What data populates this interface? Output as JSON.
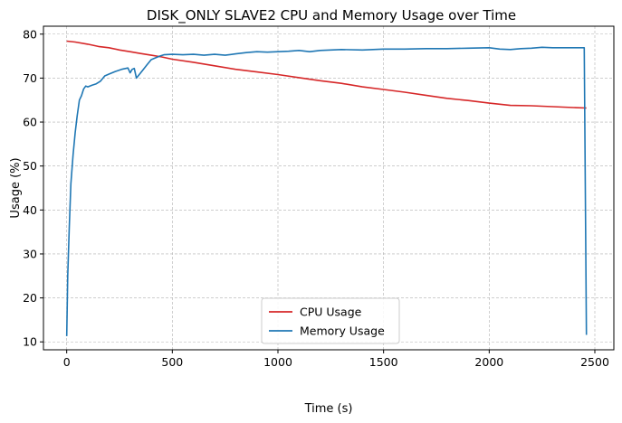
{
  "chart_data": {
    "type": "line",
    "title": "DISK_ONLY SLAVE2 CPU and Memory Usage over Time",
    "xlabel": "Time (s)",
    "ylabel": "Usage (%)",
    "xlim": [
      -110,
      2590
    ],
    "ylim": [
      8.2,
      81.8
    ],
    "xticks": [
      0,
      500,
      1000,
      1500,
      2000,
      2500
    ],
    "yticks": [
      10,
      20,
      30,
      40,
      50,
      60,
      70,
      80
    ],
    "grid": true,
    "legend": "lower-center",
    "series": [
      {
        "name": "CPU Usage",
        "color": "#d62728",
        "x": [
          0,
          40,
          100,
          150,
          200,
          250,
          300,
          350,
          400,
          450,
          500,
          600,
          700,
          800,
          900,
          1000,
          1100,
          1200,
          1300,
          1400,
          1500,
          1600,
          1700,
          1800,
          1900,
          2000,
          2100,
          2200,
          2300,
          2400,
          2460
        ],
        "y": [
          78.4,
          78.2,
          77.7,
          77.2,
          76.9,
          76.4,
          76.0,
          75.6,
          75.2,
          74.8,
          74.3,
          73.6,
          72.8,
          72.0,
          71.4,
          70.8,
          70.1,
          69.4,
          68.8,
          68.0,
          67.4,
          66.8,
          66.1,
          65.4,
          64.9,
          64.3,
          63.8,
          63.7,
          63.5,
          63.3,
          63.2
        ]
      },
      {
        "name": "Memory Usage",
        "color": "#1f77b4",
        "x": [
          0,
          5,
          12,
          20,
          30,
          40,
          50,
          60,
          70,
          80,
          90,
          100,
          120,
          140,
          160,
          180,
          200,
          230,
          260,
          290,
          300,
          310,
          320,
          330,
          340,
          360,
          380,
          400,
          420,
          440,
          460,
          500,
          550,
          600,
          650,
          700,
          750,
          800,
          850,
          900,
          950,
          1000,
          1050,
          1100,
          1150,
          1200,
          1300,
          1400,
          1500,
          1600,
          1700,
          1800,
          1900,
          2000,
          2050,
          2100,
          2150,
          2200,
          2250,
          2300,
          2350,
          2400,
          2450,
          2460
        ],
        "y": [
          11.3,
          25.0,
          36.0,
          46.0,
          52.5,
          57.5,
          61.5,
          65.0,
          66.0,
          67.5,
          68.2,
          68.0,
          68.4,
          68.7,
          69.3,
          70.5,
          70.9,
          71.5,
          72.0,
          72.3,
          71.2,
          72.0,
          72.2,
          70.0,
          70.6,
          71.8,
          73.0,
          74.2,
          74.6,
          75.0,
          75.3,
          75.4,
          75.3,
          75.4,
          75.2,
          75.4,
          75.2,
          75.5,
          75.8,
          76.0,
          75.9,
          76.0,
          76.1,
          76.3,
          76.0,
          76.3,
          76.5,
          76.4,
          76.6,
          76.6,
          76.7,
          76.7,
          76.8,
          76.9,
          76.6,
          76.5,
          76.7,
          76.8,
          77.0,
          76.9,
          76.9,
          76.9,
          76.9,
          11.6
        ]
      }
    ]
  }
}
